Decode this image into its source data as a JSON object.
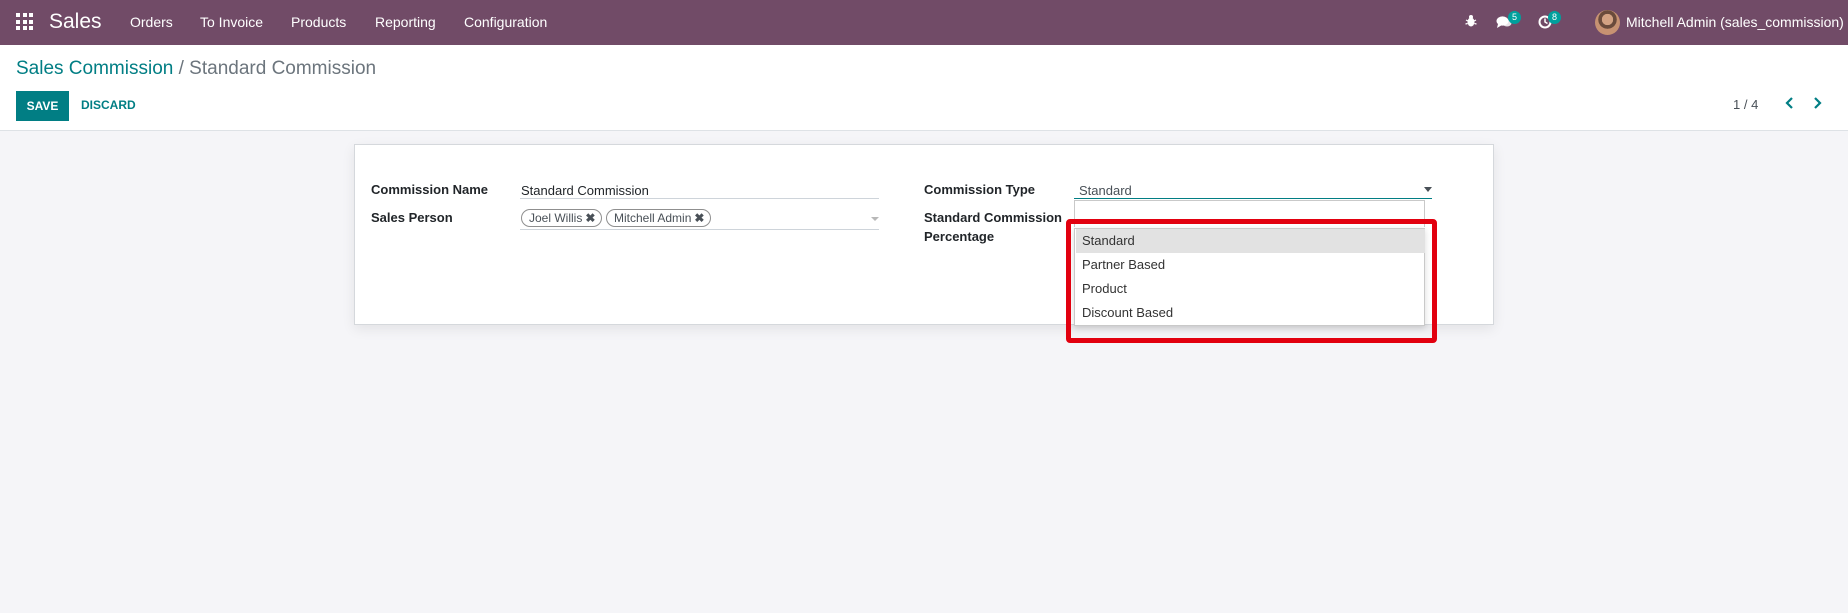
{
  "navbar": {
    "app_name": "Sales",
    "menu": [
      "Orders",
      "To Invoice",
      "Products",
      "Reporting",
      "Configuration"
    ],
    "messages_count": "5",
    "activities_count": "8",
    "user": "Mitchell Admin (sales_commission)",
    "icons": [
      "apps-grid-icon",
      "bug-icon",
      "chat-bubbles-icon",
      "clock-icon"
    ],
    "background_color": "#714b67"
  },
  "breadcrumb": {
    "parent": "Sales Commission",
    "separator": "/",
    "current": "Standard Commission"
  },
  "actions": {
    "save_label": "SAVE",
    "discard_label": "DISCARD"
  },
  "pager": {
    "text": "1 / 4"
  },
  "form": {
    "commission_name_label": "Commission Name",
    "commission_name_value": "Standard Commission",
    "sales_person_label": "Sales Person",
    "sales_person_tags": [
      "Joel Willis",
      "Mitchell Admin"
    ],
    "commission_type_label": "Commission Type",
    "commission_type_value": "Standard",
    "standard_percentage_label_line1": "Standard Commission",
    "standard_percentage_label_line2": "Percentage"
  },
  "dropdown": {
    "options": [
      "Standard",
      "Partner Based",
      "Product",
      "Discount Based"
    ],
    "selected": "Standard"
  },
  "colors": {
    "primary": "#017e84",
    "highlight": "#e2000f",
    "badge": "#00a09d"
  }
}
